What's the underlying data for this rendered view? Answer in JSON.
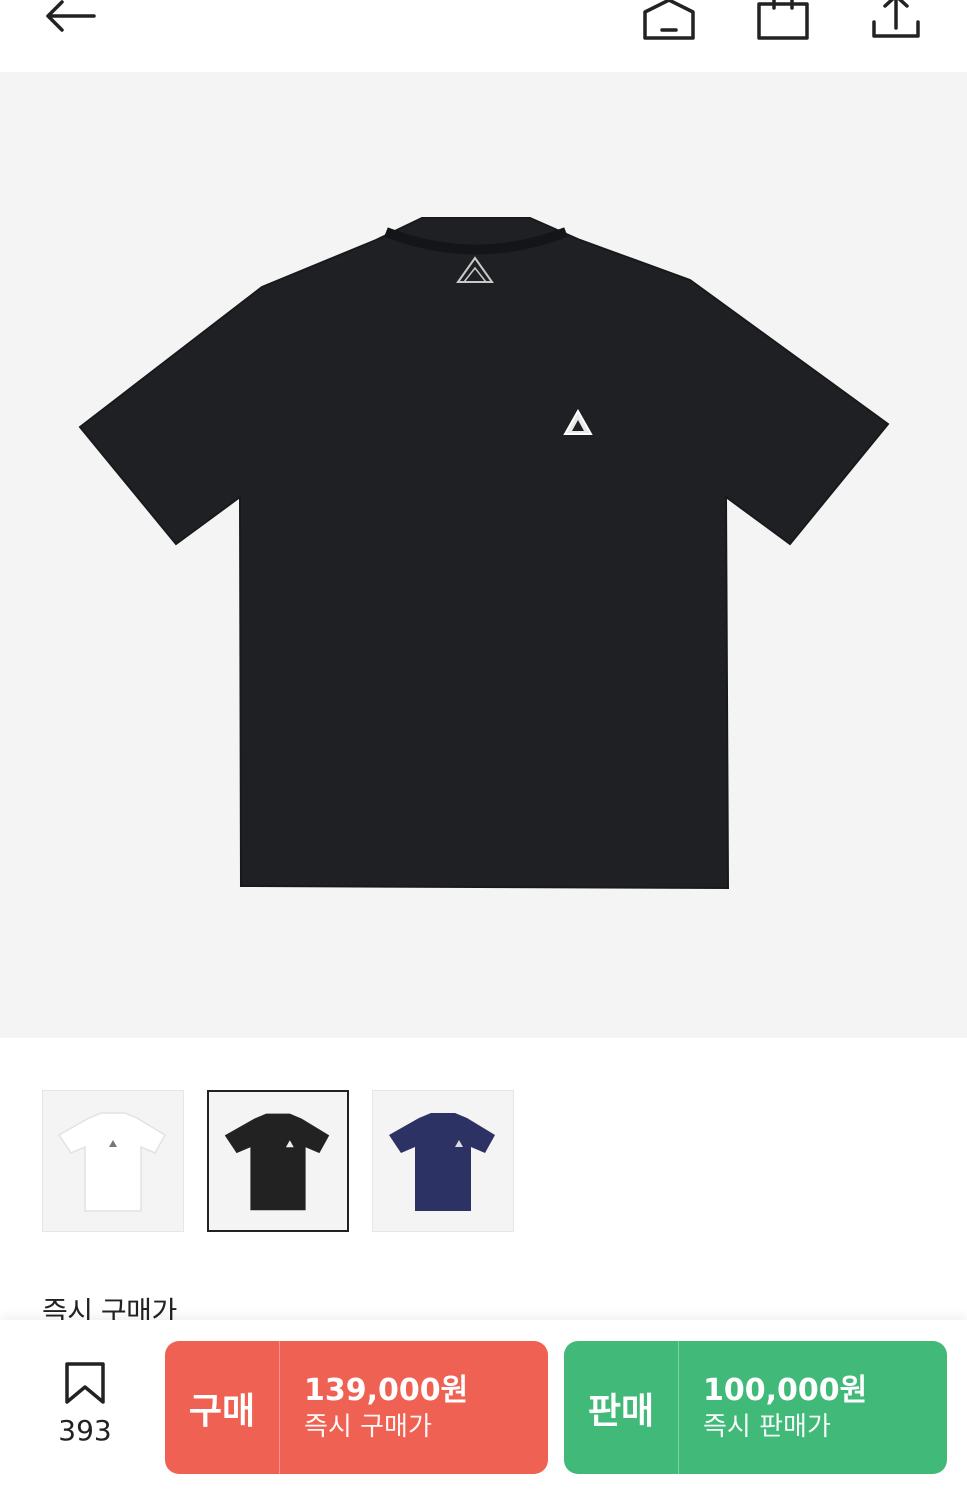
{
  "header": {
    "back_icon": "arrow-left-icon",
    "home_icon": "home-icon",
    "cart_icon": "shopping-bag-icon",
    "share_icon": "share-icon"
  },
  "gallery": {
    "main_image": "black-tshirt-front",
    "thumbnails": [
      {
        "name": "thumbnail-white-tshirt",
        "color": "#ffffff"
      },
      {
        "name": "thumbnail-black-tshirt",
        "color": "#222222",
        "selected": true
      },
      {
        "name": "thumbnail-navy-tshirt",
        "color": "#2c3263"
      }
    ]
  },
  "price_section": {
    "label": "즉시 구매가"
  },
  "bottom_bar": {
    "wish_icon": "bookmark-icon",
    "wish_count": "393",
    "buy": {
      "title": "구매",
      "price": "139,000원",
      "subtitle": "즉시 구매가",
      "color": "#ef6253"
    },
    "sell": {
      "title": "판매",
      "price": "100,000원",
      "subtitle": "즉시 판매가",
      "color": "#41b979"
    }
  }
}
